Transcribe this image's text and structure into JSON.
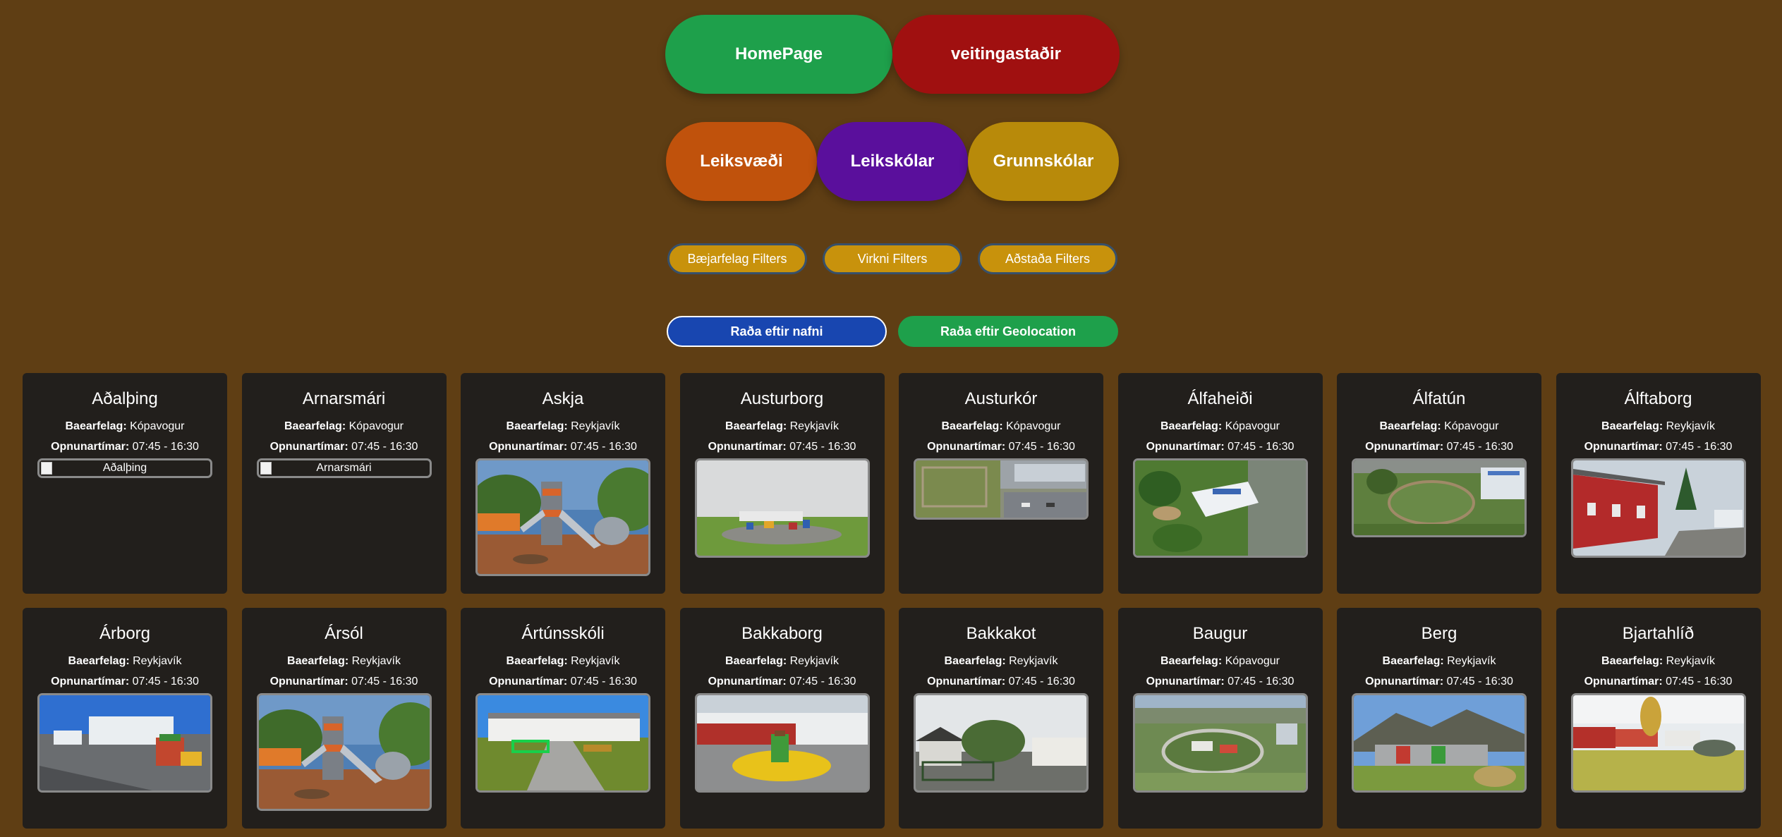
{
  "nav": {
    "home_label": "HomePage",
    "restaurants_label": "veitingastaðir",
    "home_color": "#1ea04b",
    "restaurants_color": "#a01010"
  },
  "categories": {
    "playgrounds_label": "Leiksvæði",
    "preschools_label": "Leikskólar",
    "primary_label": "Grunnskólar",
    "playgrounds_color": "#c0520c",
    "preschools_color": "#5a0f9c",
    "primary_color": "#b88a0a"
  },
  "filters": {
    "municipality_label": "Bæjarfelag Filters",
    "activity_label": "Virkni Filters",
    "facilities_label": "Aðstaða Filters"
  },
  "sort": {
    "by_name_label": "Raða eftir nafni",
    "by_geo_label": "Raða eftir Geolocation",
    "by_name_color": "#1846b0",
    "by_geo_color": "#1ea04b"
  },
  "labels": {
    "municipality": "Baearfelag:",
    "hours": "Opnunartímar:"
  },
  "items": [
    {
      "name": "Aðalþing",
      "municipality": "Kópavogur",
      "hours": "07:45 - 16:30",
      "image": "broken",
      "alt": "Aðalþing"
    },
    {
      "name": "Arnarsmári",
      "municipality": "Kópavogur",
      "hours": "07:45 - 16:30",
      "image": "broken",
      "alt": "Arnarsmári"
    },
    {
      "name": "Askja",
      "municipality": "Reykjavík",
      "hours": "07:45 - 16:30",
      "image": "playground-tower",
      "alt": "Askja"
    },
    {
      "name": "Austurborg",
      "municipality": "Reykjavík",
      "hours": "07:45 - 16:30",
      "image": "school-yard",
      "alt": "Austurborg"
    },
    {
      "name": "Austurkór",
      "municipality": "Kópavogur",
      "hours": "07:45 - 16:30",
      "image": "aerial-lot",
      "alt": "Austurkór"
    },
    {
      "name": "Álfaheiði",
      "municipality": "Kópavogur",
      "hours": "07:45 - 16:30",
      "image": "aerial-green",
      "alt": "Álfaheiði"
    },
    {
      "name": "Álfatún",
      "municipality": "Kópavogur",
      "hours": "07:45 - 16:30",
      "image": "aerial-park",
      "alt": "Álfatún"
    },
    {
      "name": "Álftaborg",
      "municipality": "Reykjavík",
      "hours": "07:45 - 16:30",
      "image": "red-building",
      "alt": "Álftaborg"
    },
    {
      "name": "Árborg",
      "municipality": "Reykjavík",
      "hours": "07:45 - 16:30",
      "image": "school-yard-blue",
      "alt": "Árborg"
    },
    {
      "name": "Ársól",
      "municipality": "Reykjavík",
      "hours": "07:45 - 16:30",
      "image": "playground-tower",
      "alt": "Ársól"
    },
    {
      "name": "Ártúnsskóli",
      "municipality": "Reykjavík",
      "hours": "07:45 - 16:30",
      "image": "school-path",
      "alt": "Ártúnsskóli"
    },
    {
      "name": "Bakkaborg",
      "municipality": "Reykjavík",
      "hours": "07:45 - 16:30",
      "image": "yellow-circle",
      "alt": "Bakkaborg"
    },
    {
      "name": "Bakkakot",
      "municipality": "Reykjavík",
      "hours": "07:45 - 16:30",
      "image": "cloudy-house",
      "alt": "Bakkakot"
    },
    {
      "name": "Baugur",
      "municipality": "Kópavogur",
      "hours": "07:45 - 16:30",
      "image": "aerial-city",
      "alt": "Baugur"
    },
    {
      "name": "Berg",
      "municipality": "Reykjavík",
      "hours": "07:45 - 16:30",
      "image": "mountain",
      "alt": "Berg"
    },
    {
      "name": "Bjartahlíð",
      "municipality": "Reykjavík",
      "hours": "07:45 - 16:30",
      "image": "red-huts",
      "alt": "Bjartahlíð"
    }
  ]
}
